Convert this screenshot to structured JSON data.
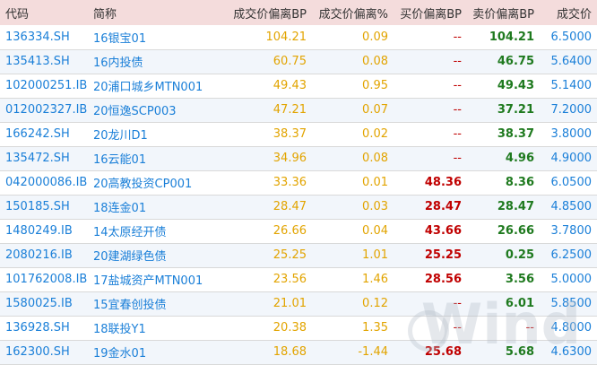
{
  "headers": [
    "代码",
    "简称",
    "成交价偏离BP",
    "成交价偏离%",
    "买价偏离BP",
    "卖价偏离BP",
    "成交价"
  ],
  "rows": [
    {
      "code": "136334.SH",
      "name": "16银宝01",
      "deal_bp": "104.21",
      "deal_pct": "0.09",
      "buy_bp": "--",
      "sell_bp": "104.21",
      "price": "6.5000"
    },
    {
      "code": "135413.SH",
      "name": "16内投债",
      "deal_bp": "60.75",
      "deal_pct": "0.08",
      "buy_bp": "--",
      "sell_bp": "46.75",
      "price": "5.6400"
    },
    {
      "code": "102000251.IB",
      "name": "20浦口城乡MTN001",
      "deal_bp": "49.43",
      "deal_pct": "0.95",
      "buy_bp": "--",
      "sell_bp": "49.43",
      "price": "5.1400"
    },
    {
      "code": "012002327.IB",
      "name": "20恒逸SCP003",
      "deal_bp": "47.21",
      "deal_pct": "0.07",
      "buy_bp": "--",
      "sell_bp": "37.21",
      "price": "7.2000"
    },
    {
      "code": "166242.SH",
      "name": "20龙川D1",
      "deal_bp": "38.37",
      "deal_pct": "0.02",
      "buy_bp": "--",
      "sell_bp": "38.37",
      "price": "3.8000"
    },
    {
      "code": "135472.SH",
      "name": "16云能01",
      "deal_bp": "34.96",
      "deal_pct": "0.08",
      "buy_bp": "--",
      "sell_bp": "4.96",
      "price": "4.9000"
    },
    {
      "code": "042000086.IB",
      "name": "20高教投资CP001",
      "deal_bp": "33.36",
      "deal_pct": "0.01",
      "buy_bp": "48.36",
      "sell_bp": "8.36",
      "price": "6.0500"
    },
    {
      "code": "150185.SH",
      "name": "18连金01",
      "deal_bp": "28.47",
      "deal_pct": "0.03",
      "buy_bp": "28.47",
      "sell_bp": "28.47",
      "price": "4.8500"
    },
    {
      "code": "1480249.IB",
      "name": "14太原经开债",
      "deal_bp": "26.66",
      "deal_pct": "0.04",
      "buy_bp": "43.66",
      "sell_bp": "26.66",
      "price": "3.7800"
    },
    {
      "code": "2080216.IB",
      "name": "20建湖绿色债",
      "deal_bp": "25.25",
      "deal_pct": "1.01",
      "buy_bp": "25.25",
      "sell_bp": "0.25",
      "price": "6.2500"
    },
    {
      "code": "101762008.IB",
      "name": "17盐城资产MTN001",
      "deal_bp": "23.56",
      "deal_pct": "1.46",
      "buy_bp": "28.56",
      "sell_bp": "3.56",
      "price": "5.0000"
    },
    {
      "code": "1580025.IB",
      "name": "15宜春创投债",
      "deal_bp": "21.01",
      "deal_pct": "0.12",
      "buy_bp": "--",
      "sell_bp": "6.01",
      "price": "5.8500"
    },
    {
      "code": "136928.SH",
      "name": "18联投Y1",
      "deal_bp": "20.38",
      "deal_pct": "1.35",
      "buy_bp": "--",
      "sell_bp": "--",
      "price": "4.8000"
    },
    {
      "code": "162300.SH",
      "name": "19金水01",
      "deal_bp": "18.68",
      "deal_pct": "-1.44",
      "buy_bp": "25.68",
      "sell_bp": "5.68",
      "price": "4.6300"
    }
  ],
  "watermark": "Wind"
}
